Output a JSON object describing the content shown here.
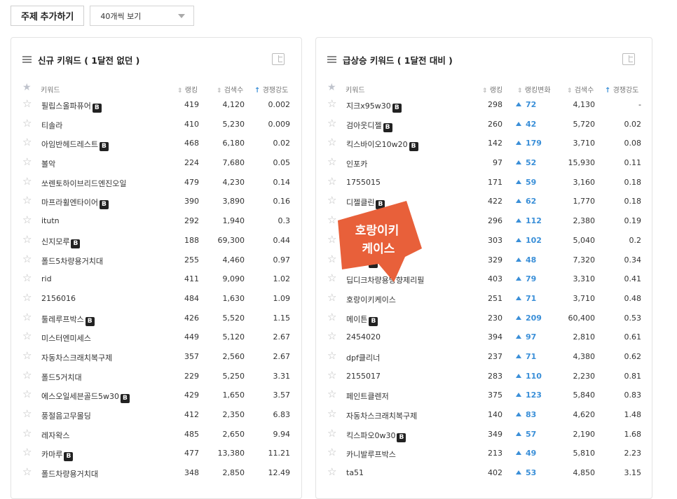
{
  "toolbar": {
    "add_label": "주제 추가하기",
    "view_select": "40개씩 보기"
  },
  "left": {
    "title": "신규 키워드 ( 1달전 없던 )",
    "headers": {
      "keyword": "키워드",
      "rank": "랭킹",
      "search": "검색수",
      "comp": "경쟁강도"
    },
    "rows": [
      {
        "kw": "필립스올파퓨어",
        "b": true,
        "rank": "419",
        "search": "4,120",
        "comp": "0.002"
      },
      {
        "kw": "티솔라",
        "b": false,
        "rank": "410",
        "search": "5,230",
        "comp": "0.009"
      },
      {
        "kw": "아임반헤드레스트",
        "b": true,
        "rank": "468",
        "search": "6,180",
        "comp": "0.02"
      },
      {
        "kw": "볼악",
        "b": false,
        "rank": "224",
        "search": "7,680",
        "comp": "0.05"
      },
      {
        "kw": "쏘렌토하이브리드엔진오일",
        "b": false,
        "rank": "479",
        "search": "4,230",
        "comp": "0.14"
      },
      {
        "kw": "마프라휠엔타이어",
        "b": true,
        "rank": "390",
        "search": "3,890",
        "comp": "0.16"
      },
      {
        "kw": "itutn",
        "b": false,
        "rank": "292",
        "search": "1,940",
        "comp": "0.3"
      },
      {
        "kw": "신지모루",
        "b": true,
        "rank": "188",
        "search": "69,300",
        "comp": "0.44"
      },
      {
        "kw": "폴드5차량용거치대",
        "b": false,
        "rank": "255",
        "search": "4,460",
        "comp": "0.97"
      },
      {
        "kw": "rid",
        "b": false,
        "rank": "411",
        "search": "9,090",
        "comp": "1.02"
      },
      {
        "kw": "2156016",
        "b": false,
        "rank": "484",
        "search": "1,630",
        "comp": "1.09"
      },
      {
        "kw": "툴레루프박스",
        "b": true,
        "rank": "426",
        "search": "5,520",
        "comp": "1.15"
      },
      {
        "kw": "미스터엔미세스",
        "b": false,
        "rank": "449",
        "search": "5,120",
        "comp": "2.67"
      },
      {
        "kw": "자동차스크래치복구제",
        "b": false,
        "rank": "357",
        "search": "2,560",
        "comp": "2.67"
      },
      {
        "kw": "폴드5거치대",
        "b": false,
        "rank": "229",
        "search": "5,250",
        "comp": "3.31"
      },
      {
        "kw": "에스오일세븐골드5w30",
        "b": true,
        "rank": "429",
        "search": "1,650",
        "comp": "3.57"
      },
      {
        "kw": "풍절음고무몰딩",
        "b": false,
        "rank": "412",
        "search": "2,350",
        "comp": "6.83"
      },
      {
        "kw": "레자왁스",
        "b": false,
        "rank": "485",
        "search": "2,650",
        "comp": "9.94"
      },
      {
        "kw": "카마루",
        "b": true,
        "rank": "477",
        "search": "13,380",
        "comp": "11.21"
      },
      {
        "kw": "폴드차량용거치대",
        "b": false,
        "rank": "348",
        "search": "2,850",
        "comp": "12.49"
      }
    ]
  },
  "right": {
    "title": "급상승 키워드 ( 1달전 대비 )",
    "headers": {
      "keyword": "키워드",
      "rank": "랭킹",
      "change": "랭킹변화",
      "search": "검색수",
      "comp": "경쟁강도"
    },
    "rows": [
      {
        "kw": "지크x95w30",
        "b": true,
        "rank": "298",
        "chg": "72",
        "search": "4,130",
        "comp": "-"
      },
      {
        "kw": "검아웃디젤",
        "b": true,
        "rank": "260",
        "chg": "42",
        "search": "5,720",
        "comp": "0.02"
      },
      {
        "kw": "킥스바이오10w20",
        "b": true,
        "rank": "142",
        "chg": "179",
        "search": "3,710",
        "comp": "0.08"
      },
      {
        "kw": "인포카",
        "b": false,
        "rank": "97",
        "chg": "52",
        "search": "15,930",
        "comp": "0.11"
      },
      {
        "kw": "1755015",
        "b": false,
        "rank": "171",
        "chg": "59",
        "search": "3,160",
        "comp": "0.18"
      },
      {
        "kw": "디젤클린",
        "b": true,
        "rank": "422",
        "chg": "62",
        "search": "1,770",
        "comp": "0.18"
      },
      {
        "kw": "",
        "b": false,
        "rank": "296",
        "chg": "112",
        "search": "2,380",
        "comp": "0.19"
      },
      {
        "kw": "",
        "b": false,
        "rank": "303",
        "chg": "102",
        "search": "5,040",
        "comp": "0.2"
      },
      {
        "kw": "케이스",
        "b": true,
        "rank": "329",
        "chg": "48",
        "search": "7,320",
        "comp": "0.34"
      },
      {
        "kw": "딥디크차량용방향제리필",
        "b": false,
        "rank": "403",
        "chg": "79",
        "search": "3,310",
        "comp": "0.41"
      },
      {
        "kw": "호랑이키케이스",
        "b": false,
        "rank": "251",
        "chg": "71",
        "search": "3,710",
        "comp": "0.48"
      },
      {
        "kw": "메이튼",
        "b": true,
        "rank": "230",
        "chg": "209",
        "search": "60,400",
        "comp": "0.53"
      },
      {
        "kw": "2454020",
        "b": false,
        "rank": "394",
        "chg": "97",
        "search": "2,810",
        "comp": "0.61"
      },
      {
        "kw": "dpf클리너",
        "b": false,
        "rank": "237",
        "chg": "71",
        "search": "4,380",
        "comp": "0.62"
      },
      {
        "kw": "2155017",
        "b": false,
        "rank": "283",
        "chg": "110",
        "search": "2,230",
        "comp": "0.81"
      },
      {
        "kw": "페인트클렌저",
        "b": false,
        "rank": "375",
        "chg": "123",
        "search": "5,840",
        "comp": "0.83"
      },
      {
        "kw": "자동차스크래치복구제",
        "b": false,
        "rank": "140",
        "chg": "83",
        "search": "4,620",
        "comp": "1.48"
      },
      {
        "kw": "킥스파오0w30",
        "b": true,
        "rank": "349",
        "chg": "57",
        "search": "2,190",
        "comp": "1.68"
      },
      {
        "kw": "카니발루프박스",
        "b": false,
        "rank": "213",
        "chg": "49",
        "search": "5,810",
        "comp": "2.23"
      },
      {
        "kw": "ta51",
        "b": false,
        "rank": "402",
        "chg": "53",
        "search": "4,850",
        "comp": "3.15"
      }
    ]
  },
  "badge_letter": "B",
  "overlay": {
    "line1": "호랑이키",
    "line2": "케이스",
    "color": "#e8603a"
  }
}
